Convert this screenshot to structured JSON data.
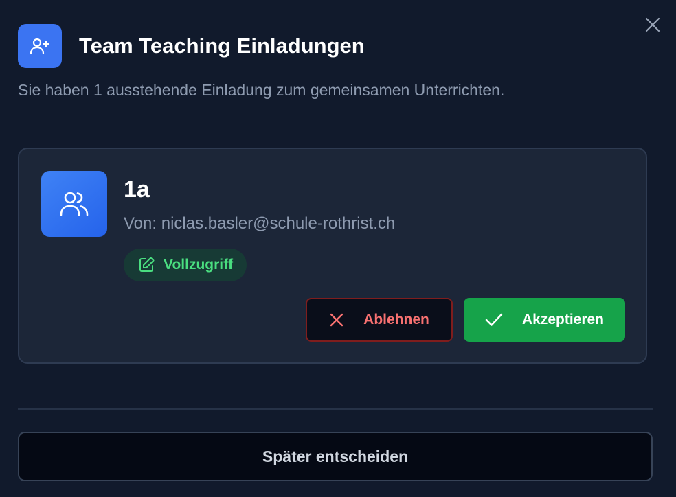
{
  "dialog": {
    "title": "Team Teaching Einladungen",
    "subtitle": "Sie haben 1 ausstehende Einladung zum gemeinsamen Unterrichten.",
    "header_icon": "user-plus-icon",
    "close_icon": "close-icon"
  },
  "invitation": {
    "class_name": "1a",
    "from": "Von: niclas.basler@schule-rothrist.ch",
    "class_icon": "users-icon",
    "access": {
      "label": "Vollzugriff",
      "icon": "edit-icon"
    },
    "reject_label": "Ablehnen",
    "accept_label": "Akzeptieren"
  },
  "footer": {
    "later_label": "Später entscheiden"
  },
  "colors": {
    "background": "#111a2c",
    "card": "#1c2638",
    "accent_blue": "#3b74f2",
    "accept_green": "#16a34a",
    "reject_red": "#f87171",
    "badge_green": "#4ade80"
  }
}
